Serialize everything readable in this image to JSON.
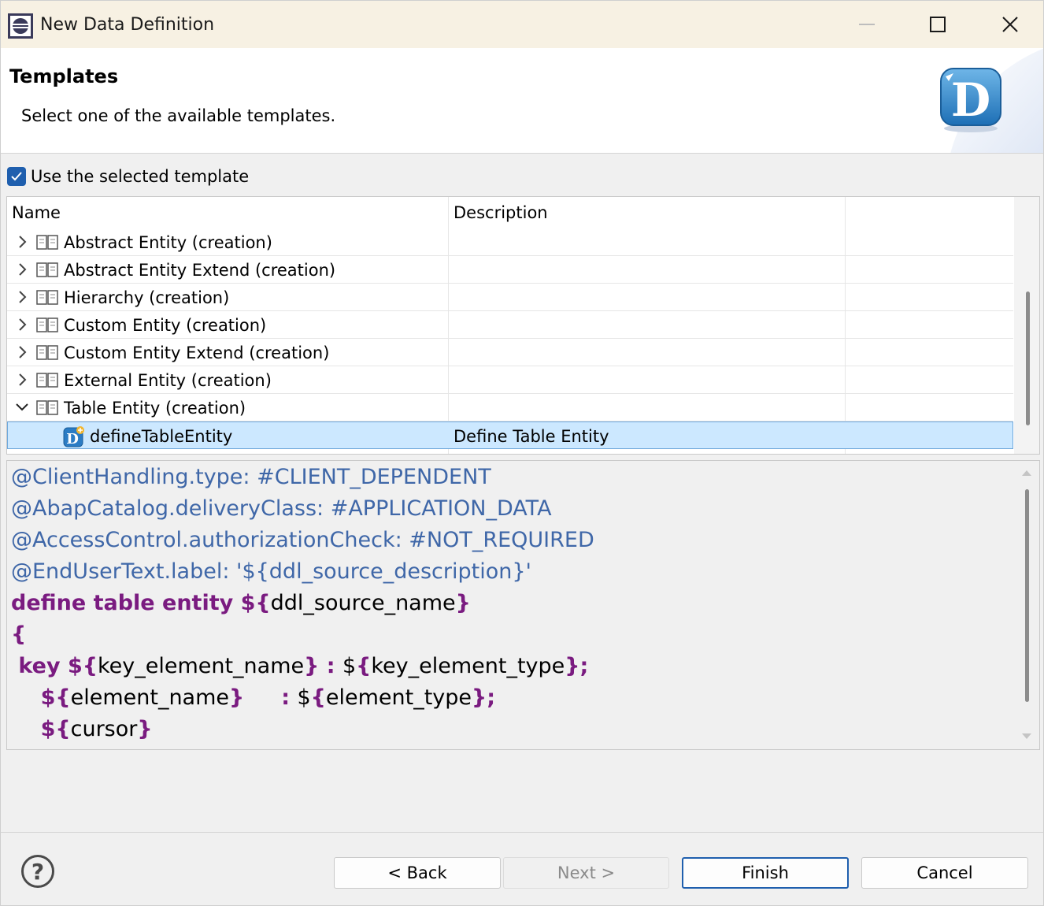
{
  "window": {
    "title": "New Data Definition",
    "minimize_icon": "minimize-icon",
    "maximize_icon": "maximize-icon",
    "close_icon": "close-icon"
  },
  "header": {
    "title": "Templates",
    "message": "Select one of the available templates.",
    "logo_icon": "ddl-source-logo-icon",
    "logo_letter": "D"
  },
  "use_template": {
    "label": "Use the selected template",
    "checked": true
  },
  "table": {
    "columns": [
      "Name",
      "Description",
      ""
    ],
    "rows": [
      {
        "label": "Abstract Entity (creation)",
        "description": "",
        "expanded": false
      },
      {
        "label": "Abstract Entity Extend (creation)",
        "description": "",
        "expanded": false
      },
      {
        "label": "Hierarchy (creation)",
        "description": "",
        "expanded": false
      },
      {
        "label": "Custom Entity (creation)",
        "description": "",
        "expanded": false
      },
      {
        "label": "Custom Entity Extend (creation)",
        "description": "",
        "expanded": false
      },
      {
        "label": "External Entity (creation)",
        "description": "",
        "expanded": false
      },
      {
        "label": "Table Entity (creation)",
        "description": "",
        "expanded": true
      }
    ],
    "selected_child": {
      "label": "defineTableEntity",
      "description": "Define Table Entity"
    }
  },
  "preview": {
    "lines": [
      [
        {
          "t": "@ClientHandling.type: #CLIENT_DEPENDENT",
          "c": "ann"
        }
      ],
      [
        {
          "t": "@AbapCatalog.deliveryClass: #APPLICATION_DATA",
          "c": "ann"
        }
      ],
      [
        {
          "t": "@AccessControl.authorizationCheck: #NOT_REQUIRED",
          "c": "ann"
        }
      ],
      [
        {
          "t": "@EndUserText.label: '${ddl_source_description}'",
          "c": "ann"
        }
      ],
      [
        {
          "t": "define table entity ${",
          "c": "kw"
        },
        {
          "t": "ddl_source_name",
          "c": "plain"
        },
        {
          "t": "}",
          "c": "kw"
        }
      ],
      [
        {
          "t": "{",
          "c": "kw"
        }
      ],
      [
        {
          "t": " key ${",
          "c": "kw"
        },
        {
          "t": "key_element_name",
          "c": "plain"
        },
        {
          "t": "} : ",
          "c": "kw"
        },
        {
          "t": "$",
          "c": "plain"
        },
        {
          "t": "{",
          "c": "kw"
        },
        {
          "t": "key_element_type",
          "c": "plain"
        },
        {
          "t": "};",
          "c": "kw"
        }
      ],
      [
        {
          "t": "    ${",
          "c": "kw"
        },
        {
          "t": "element_name",
          "c": "plain"
        },
        {
          "t": "}     : ",
          "c": "kw"
        },
        {
          "t": "$",
          "c": "plain"
        },
        {
          "t": "{",
          "c": "kw"
        },
        {
          "t": "element_type",
          "c": "plain"
        },
        {
          "t": "};",
          "c": "kw"
        }
      ],
      [
        {
          "t": "    ${",
          "c": "kw"
        },
        {
          "t": "cursor",
          "c": "plain"
        },
        {
          "t": "}",
          "c": "kw"
        }
      ]
    ]
  },
  "buttons": {
    "help_icon": "help-icon",
    "help_glyph": "?",
    "back": "< Back",
    "next": "Next >",
    "finish": "Finish",
    "cancel": "Cancel"
  }
}
